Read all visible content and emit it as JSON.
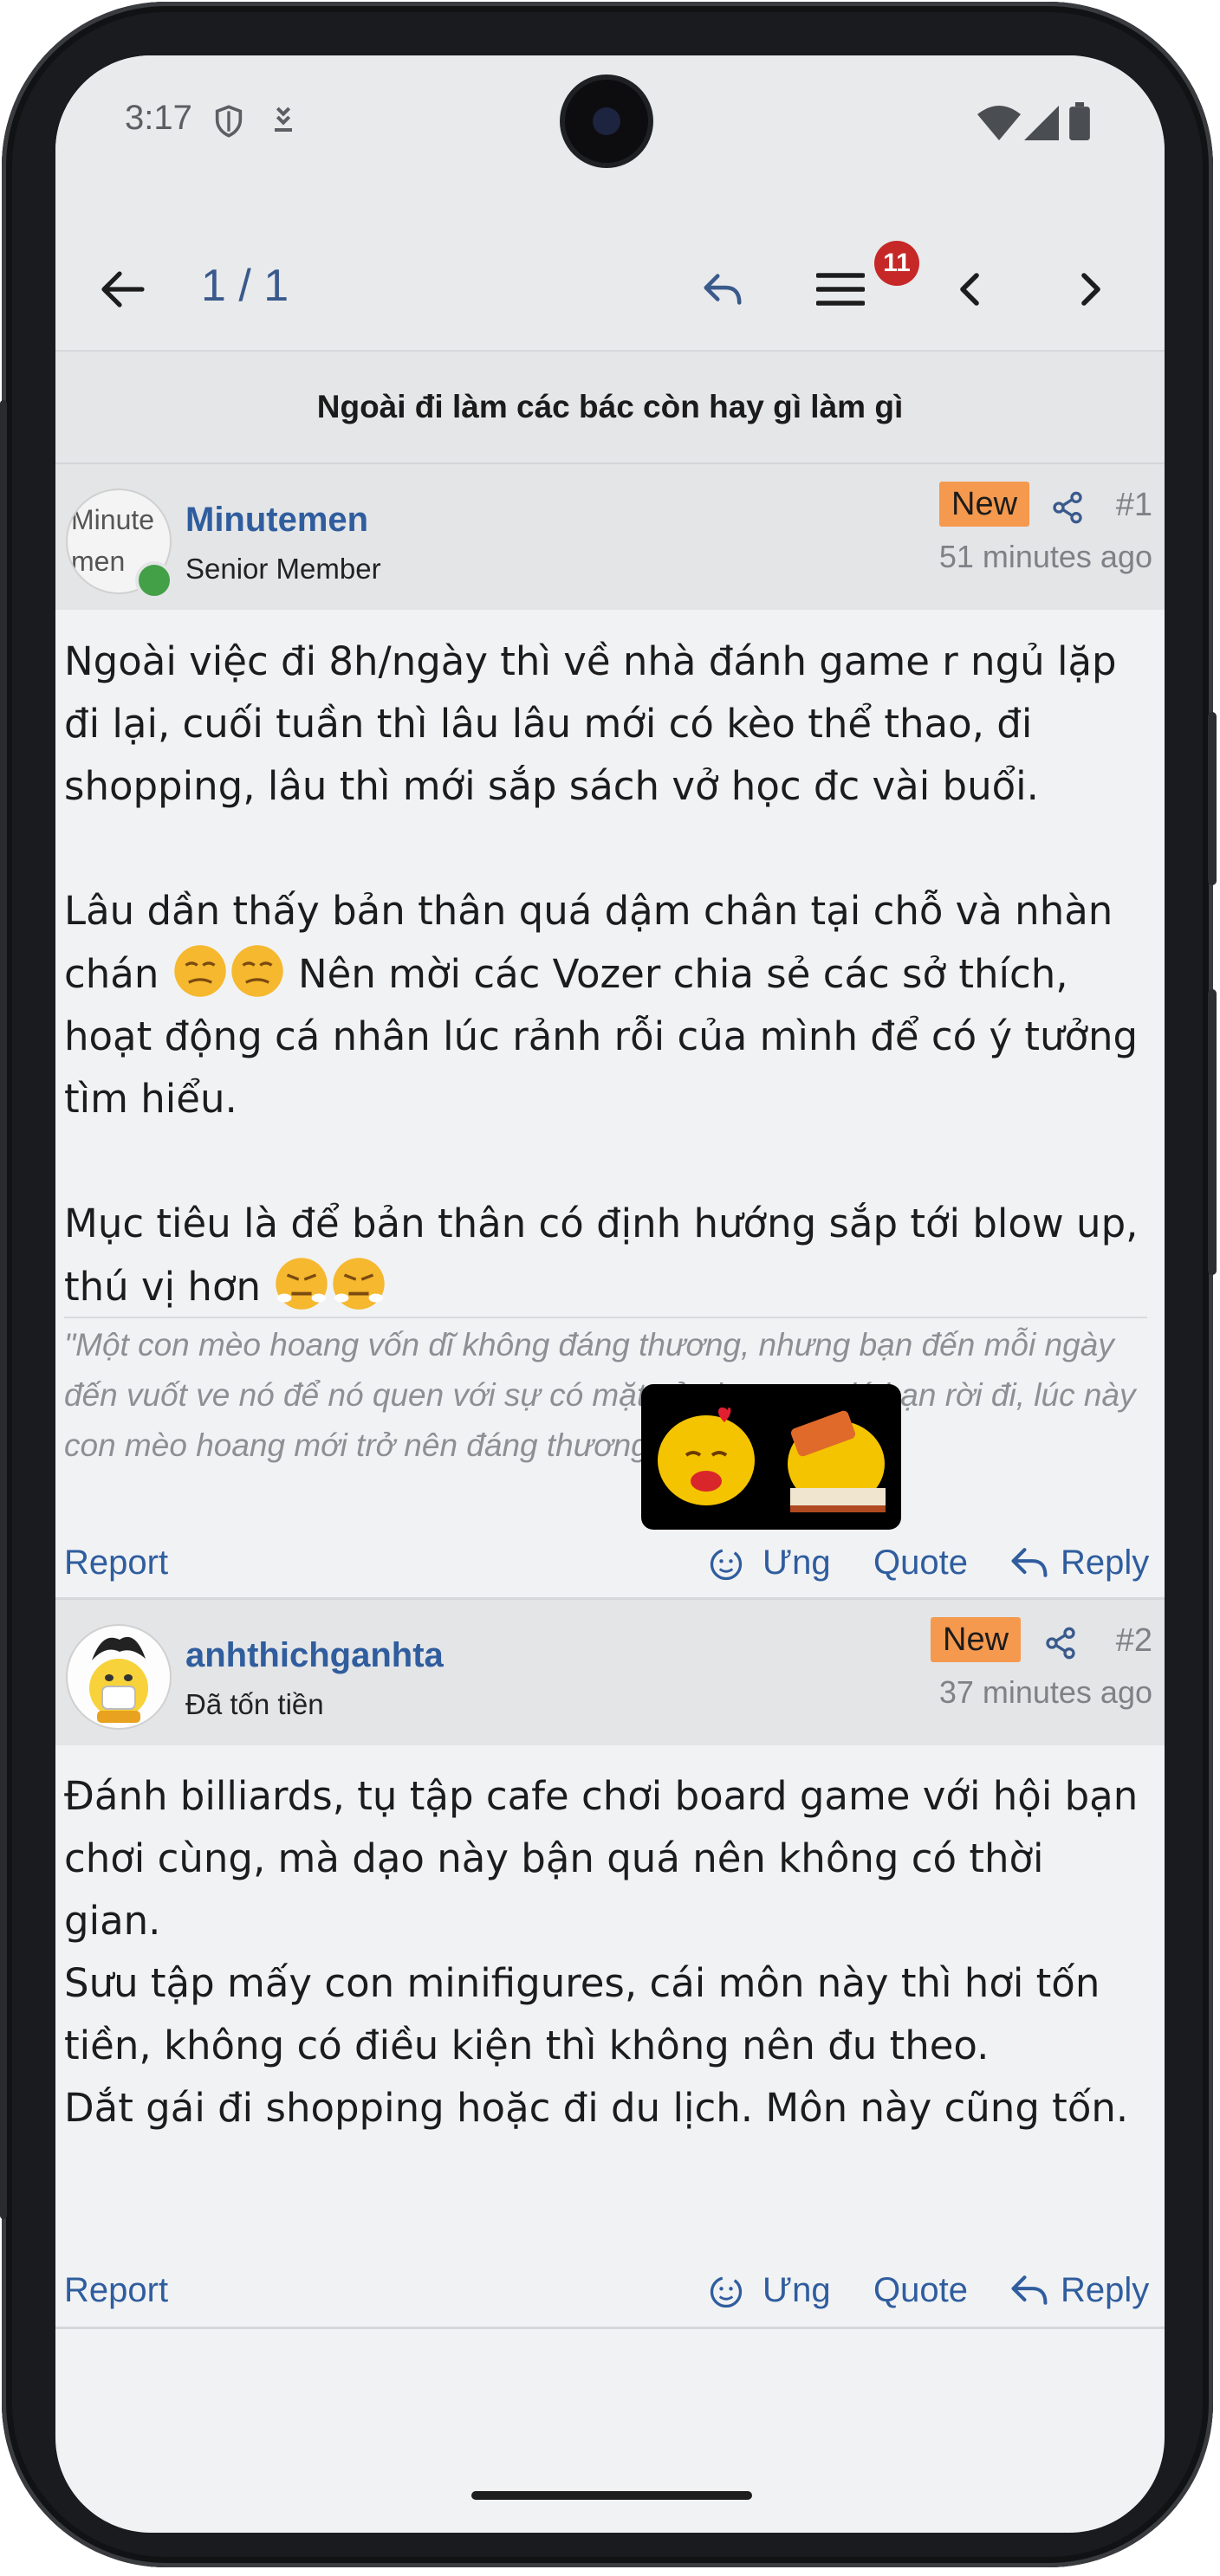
{
  "status_bar": {
    "time": "3:17"
  },
  "app_bar": {
    "page_indicator": "1 / 1",
    "notification_count": "11"
  },
  "thread": {
    "title": "Ngoài đi làm các bác còn hay gì làm gì"
  },
  "posts": [
    {
      "username": "Minutemen",
      "user_title": "Senior Member",
      "avatar_alt": "Minutemen",
      "new_label": "New",
      "number": "#1",
      "time": "51 minutes ago",
      "paragraphs": [
        "Ngoài việc đi 8h/ngày thì về nhà đánh game r ngủ lặp đi lại, cuối tuần thì lâu lâu mới có kèo thể thao, đi shopping, lâu thì mới sắp sách vở học đc vài buổi.",
        "Lâu dần thấy bản thân quá dậm chân tại chỗ và nhàn chán",
        " Nên mời các Vozer chia sẻ các sở thích, hoạt động cá nhân lúc rảnh rỗi của mình để có ý tưởng tìm hiểu.",
        "Mục tiêu là để bản thân có định hướng sắp tới blow up, thú vị hơn"
      ],
      "signature": "\"Một con mèo hoang vốn dĩ không đáng thương, nhưng bạn đến mỗi ngày đến vuốt ve nó để nó quen với sự có mặt của bạn sau đó bạn rời đi, lúc này con mèo hoang mới trở nên đáng thương.\"",
      "actions": {
        "report": "Report",
        "react": "Ưng",
        "quote": "Quote",
        "reply": "Reply"
      }
    },
    {
      "username": "anhthichganhta",
      "user_title": "Đã tốn tiền",
      "new_label": "New",
      "number": "#2",
      "time": "37 minutes ago",
      "paragraphs": [
        "Đánh billiards, tụ tập cafe chơi board game với hội bạn chơi cùng, mà dạo này bận quá nên không có thời gian.",
        "Sưu tập mấy con minifigures, cái môn này thì hơi tốn tiền, không có điều kiện thì không nên đu theo.",
        "Dắt gái đi shopping hoặc đi du lịch. Môn này cũng tốn."
      ],
      "actions": {
        "report": "Report",
        "react": "Ưng",
        "quote": "Quote",
        "reply": "Reply"
      }
    }
  ],
  "icons": {
    "back": "arrow-left-icon",
    "reply_all": "reply-icon",
    "menu": "hamburger-menu-icon",
    "prev": "chevron-left-icon",
    "next": "chevron-right-icon",
    "share": "share-icon",
    "react": "react-emoji-icon"
  },
  "colors": {
    "link": "#2f5d9e",
    "new_badge": "#f5994e",
    "notification_badge": "#c62828",
    "online": "#43a047"
  }
}
